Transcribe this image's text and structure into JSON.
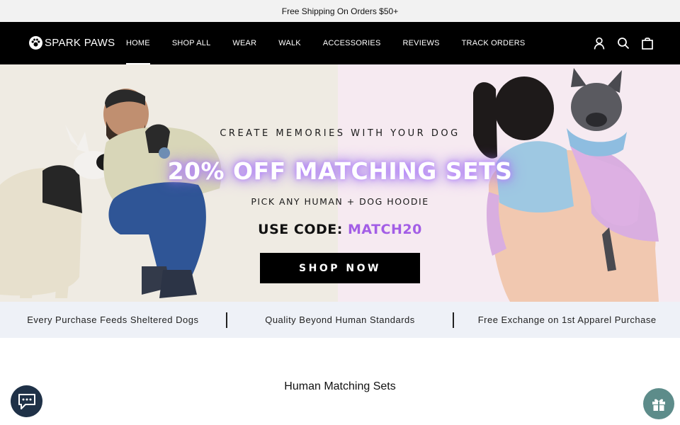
{
  "announcement": "Free Shipping On Orders $50+",
  "brand": {
    "name": "SPARK PAWS",
    "logo_icon": "paw-icon"
  },
  "nav": {
    "items": [
      {
        "label": "HOME",
        "active": true
      },
      {
        "label": "SHOP ALL"
      },
      {
        "label": "WEAR"
      },
      {
        "label": "WALK"
      },
      {
        "label": "ACCESSORIES"
      },
      {
        "label": "REVIEWS"
      },
      {
        "label": "TRACK ORDERS"
      }
    ],
    "icons": [
      "account-icon",
      "search-icon",
      "cart-icon"
    ]
  },
  "hero": {
    "eyebrow": "CREATE MEMORIES WITH YOUR DOG",
    "headline": "20% OFF MATCHING SETS",
    "subline": "PICK ANY HUMAN + DOG HOODIE",
    "code_prefix": "USE CODE: ",
    "code": "MATCH20",
    "cta": "SHOP NOW",
    "colors": {
      "left_bg": "#efebe3",
      "right_bg": "#f6eaf1",
      "code_color": "#a35ee6"
    }
  },
  "benefits": [
    "Every Purchase Feeds Sheltered Dogs",
    "Quality Beyond Human Standards",
    "Free Exchange on 1st Apparel Purchase"
  ],
  "section_title": "Human Matching Sets",
  "widgets": {
    "chat_icon": "chat-icon",
    "gift_icon": "gift-icon"
  }
}
